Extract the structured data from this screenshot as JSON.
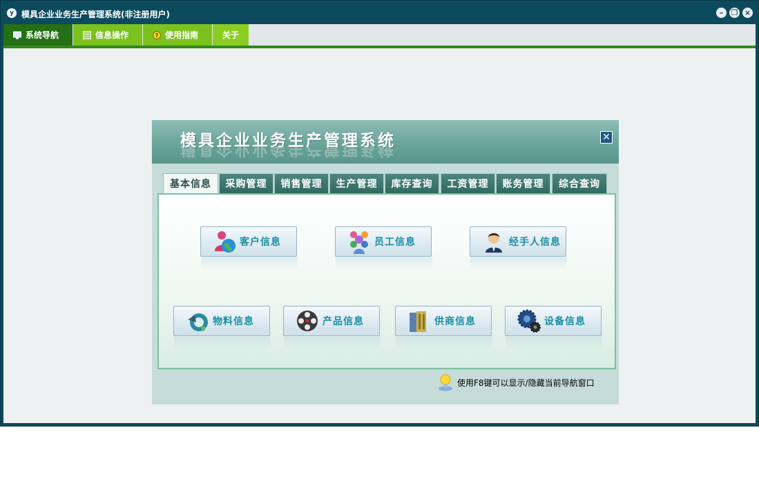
{
  "window": {
    "title": "模具企业业务生产管理系统(非注册用户)",
    "app_icon_text": "y",
    "controls": [
      "minimize",
      "restore",
      "close"
    ]
  },
  "menubar": {
    "items": [
      {
        "label": "系统导航",
        "icon": "monitor-icon"
      },
      {
        "label": "信息操作",
        "icon": "grid-icon"
      },
      {
        "label": "使用指南",
        "icon": "help-icon"
      },
      {
        "label": "关于",
        "icon": ""
      }
    ]
  },
  "panel": {
    "title": "模具企业业务生产管理系统",
    "close_symbol": "✕",
    "tabs": [
      "基本信息",
      "采购管理",
      "销售管理",
      "生产管理",
      "库存查询",
      "工资管理",
      "账务管理",
      "综合查询"
    ],
    "active_tab": "基本信息",
    "buttons_row1": [
      {
        "label": "客户信息",
        "icon": "customer-icon"
      },
      {
        "label": "员工信息",
        "icon": "employee-icon"
      },
      {
        "label": "经手人信息",
        "icon": "handler-icon"
      }
    ],
    "buttons_row2": [
      {
        "label": "物料信息",
        "icon": "material-icon"
      },
      {
        "label": "产品信息",
        "icon": "product-icon"
      },
      {
        "label": "供商信息",
        "icon": "supplier-icon"
      },
      {
        "label": "设备信息",
        "icon": "equipment-icon"
      }
    ],
    "tip": "使用F8键可以显示/隐藏当前导航窗口"
  },
  "colors": {
    "window_frame": "#0c4a5e",
    "menu_active": "#256f14",
    "menu_item": "#7cc21e",
    "menu_underline": "#2f8a1c",
    "panel_header": "#6aa49b",
    "button_text": "#1a8fa6"
  }
}
